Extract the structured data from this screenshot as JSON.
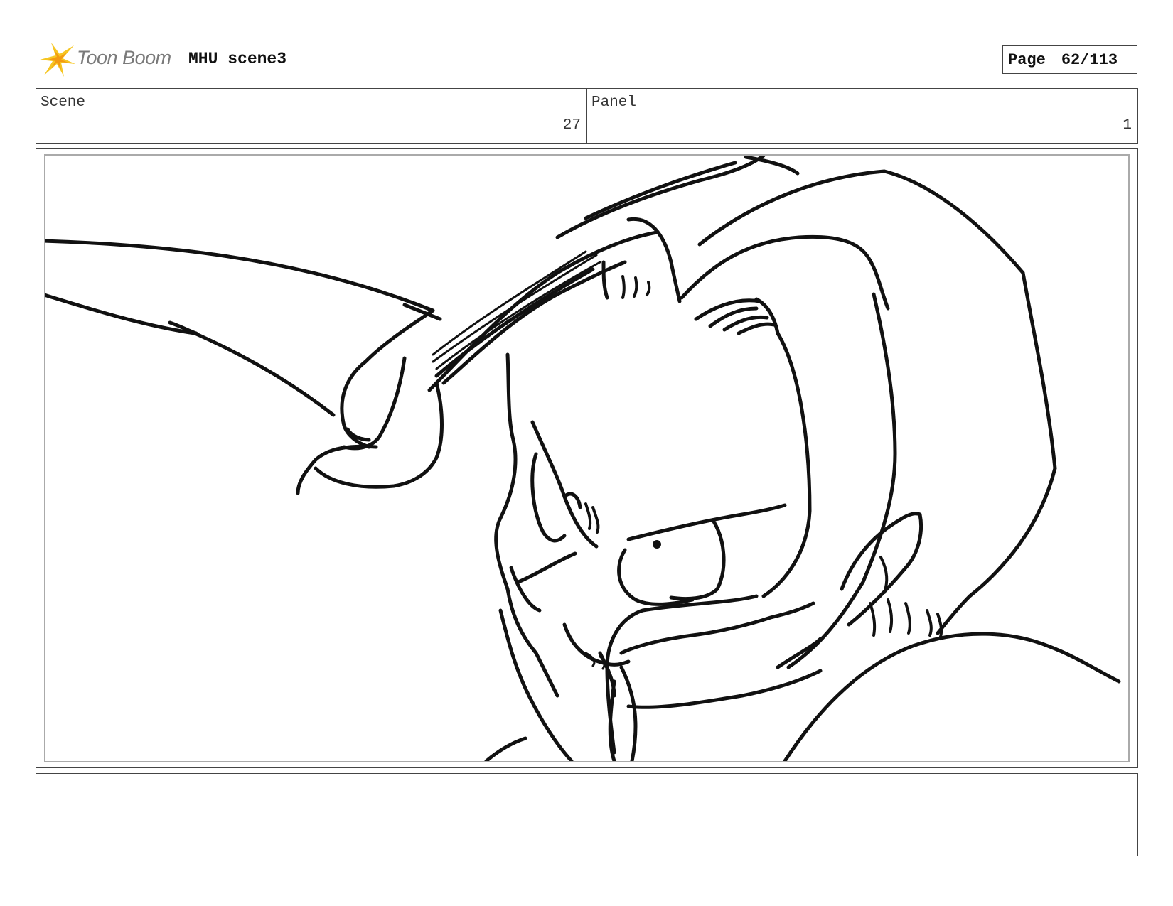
{
  "header": {
    "logo_text": "Toon Boom",
    "logo_icon": "toon-boom-star-icon",
    "title": "MHU scene3",
    "page_label": "Page",
    "page_number": "62/113"
  },
  "info": {
    "scene_label": "Scene",
    "scene_value": "27",
    "panel_label": "Panel",
    "panel_value": "1"
  },
  "sketch": {
    "description_icon": "storyboard-sketch"
  },
  "notes": {
    "text": ""
  },
  "colors": {
    "logo_accent": "#f4b400",
    "border": "#444444",
    "inner_border": "#aaaaaa"
  }
}
